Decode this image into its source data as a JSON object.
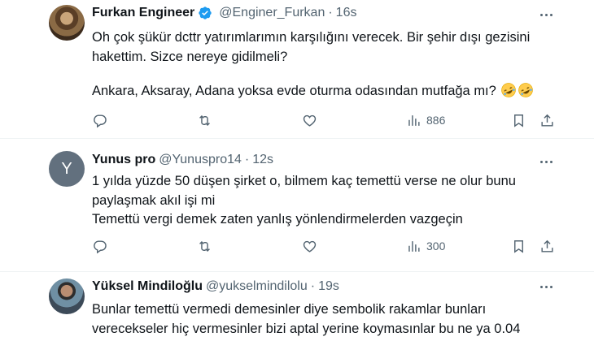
{
  "tweets": [
    {
      "author_name": "Furkan Engineer",
      "verified": true,
      "handle": "@Enginer_Furkan",
      "separator": "·",
      "time": "16s",
      "lines": [
        "Oh çok şükür dcttr yatırımlarımın karşılığını verecek. Bir şehir dışı gezisini",
        "hakettim. Sizce nereye gidilmeli?",
        "Ankara, Aksaray, Adana yoksa evde oturma odasından mutfağa mı?"
      ],
      "emoji": [
        "rolling-on-floor-laughing",
        "rolling-on-floor-laughing"
      ],
      "views": "886"
    },
    {
      "author_name": "Yunus pro",
      "avatar_letter": "Y",
      "handle": "@Yunuspro14",
      "separator": "·",
      "time": "12s",
      "lines": [
        "1 yılda yüzde 50 düşen şirket o, bilmem kaç temettü verse ne olur bunu",
        "paylaşmak akıl işi mi",
        "Temettü vergi demek zaten yanlış yönlendirmelerden vazgeçin"
      ],
      "views": "300"
    },
    {
      "author_name": "Yüksel Mindiloğlu",
      "handle": "@yukselmindilolu",
      "separator": "·",
      "time": "19s",
      "lines": [
        "Bunlar temettü vermedi demesinler diye sembolik rakamlar bunları",
        "verecekseler hiç vermesinler bizi aptal yerine koymasınlar bu ne ya 0.04"
      ]
    }
  ],
  "colors": {
    "text": "#0f1419",
    "secondary": "#536471",
    "verified": "#1d9bf0",
    "divider": "#eff3f4"
  }
}
